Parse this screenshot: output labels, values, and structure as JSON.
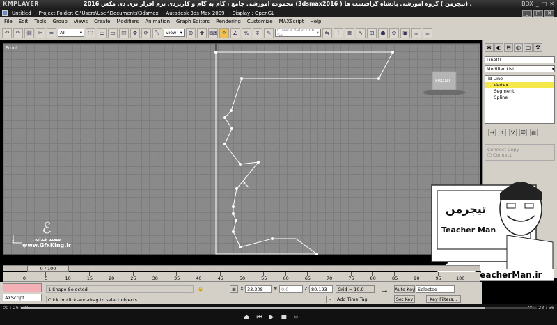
{
  "player": {
    "logo": "KMPLAYER",
    "caption": "مجموعه آموزشی جامع ، گام به گام و کاربردی نرم افزار تری دی مکس 2016  (3dsmax2016  )  مدرس : سعید فدایی (تیچرمن ) گروه آموزشی پادشاه گرافیست ها",
    "right_label": "BOX",
    "time_left": "00 : 26 : 01",
    "time_right": "00 : 28 : 56",
    "progress_fraction": 0.9
  },
  "app": {
    "title_doc": "Untitled",
    "title_folder": "- Project Folder: C:\\Users\\User\\Documents\\3dsmax",
    "title_app": "- Autodesk 3ds Max  2009",
    "title_display": "- Display : OpenGL"
  },
  "menu": [
    "File",
    "Edit",
    "Tools",
    "Group",
    "Views",
    "Create",
    "Modifiers",
    "Animation",
    "Graph Editors",
    "Rendering",
    "Customize",
    "MAXScript",
    "Help"
  ],
  "toolbar": {
    "filter_value": "All",
    "refcoord_value": "View",
    "selection_set_placeholder": "Create Selection Se"
  },
  "viewport": {
    "label": "Front",
    "viewcube_label": "FRONT"
  },
  "command_panel": {
    "object_name": "Line01",
    "modifier_list": "Modifier List",
    "stack": [
      "Line",
      "Vertex",
      "Segment",
      "Spline"
    ],
    "stack_selected": "Vertex",
    "rollout_title": "Connect Copy",
    "rollout_item": "Connect"
  },
  "timeline": {
    "frame_display": "0 / 100",
    "ticks": [
      0,
      5,
      10,
      15,
      20,
      25,
      30,
      35,
      40,
      45,
      50,
      55,
      60,
      65,
      70,
      75,
      80,
      85,
      90,
      95,
      100
    ]
  },
  "status": {
    "maxscript_label": "AXScript.",
    "selection_info": "1 Shape Selected",
    "prompt": "Click or click-and-drag to select objects",
    "x_label": "X:",
    "x_value": "33.308",
    "y_label": "Y:",
    "y_value": "0.0",
    "z_label": "Z:",
    "z_value": "80.193",
    "grid": "Grid = 10.0",
    "add_time_tag": "Add Time Tag",
    "auto_key": "Auto Key",
    "set_key": "Set Key",
    "selected_value": "Selected",
    "key_filters": "Key Filters..."
  },
  "logos": {
    "gfx_name": "سعید فدایی",
    "gfx_url": "www.GfxKing.ir",
    "teacher_name": "Teacher Man",
    "teacher_url": "www.TeacherMan.ir"
  },
  "icons": {
    "undo": "undo-icon",
    "redo": "redo-icon",
    "select": "select-arrow-icon",
    "move": "move-icon",
    "rotate": "rotate-icon",
    "scale": "scale-icon"
  }
}
